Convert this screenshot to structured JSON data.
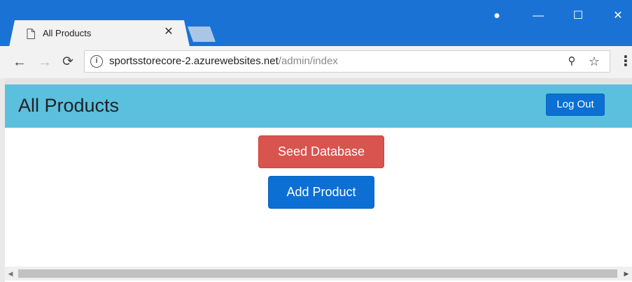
{
  "browser": {
    "tab": {
      "title": "All Products",
      "close_glyph": "✕",
      "icon": "page-icon"
    },
    "new_tab_icon": "new-tab-icon",
    "window_controls": {
      "account": "●",
      "minimize": "—",
      "maximize": "☐",
      "close": "✕"
    },
    "nav": {
      "back": "←",
      "forward": "→",
      "reload": "⟳"
    },
    "address": {
      "info": "i",
      "url_domain": "sportsstorecore-2.azurewebsites.net",
      "url_path": "/admin/index"
    },
    "toolbar_icons": {
      "key": "⚲",
      "star": "☆",
      "menu": "⋮"
    },
    "accent_color": "#1a73d4"
  },
  "page": {
    "header": {
      "title": "All Products",
      "background": "#5bc0de"
    },
    "logout_label": "Log Out",
    "seed_label": "Seed Database",
    "add_label": "Add Product",
    "colors": {
      "primary": "#0b6fd4",
      "danger": "#d9534f"
    }
  },
  "scrollbar": {
    "left_arrow": "◀",
    "right_arrow": "▶"
  }
}
